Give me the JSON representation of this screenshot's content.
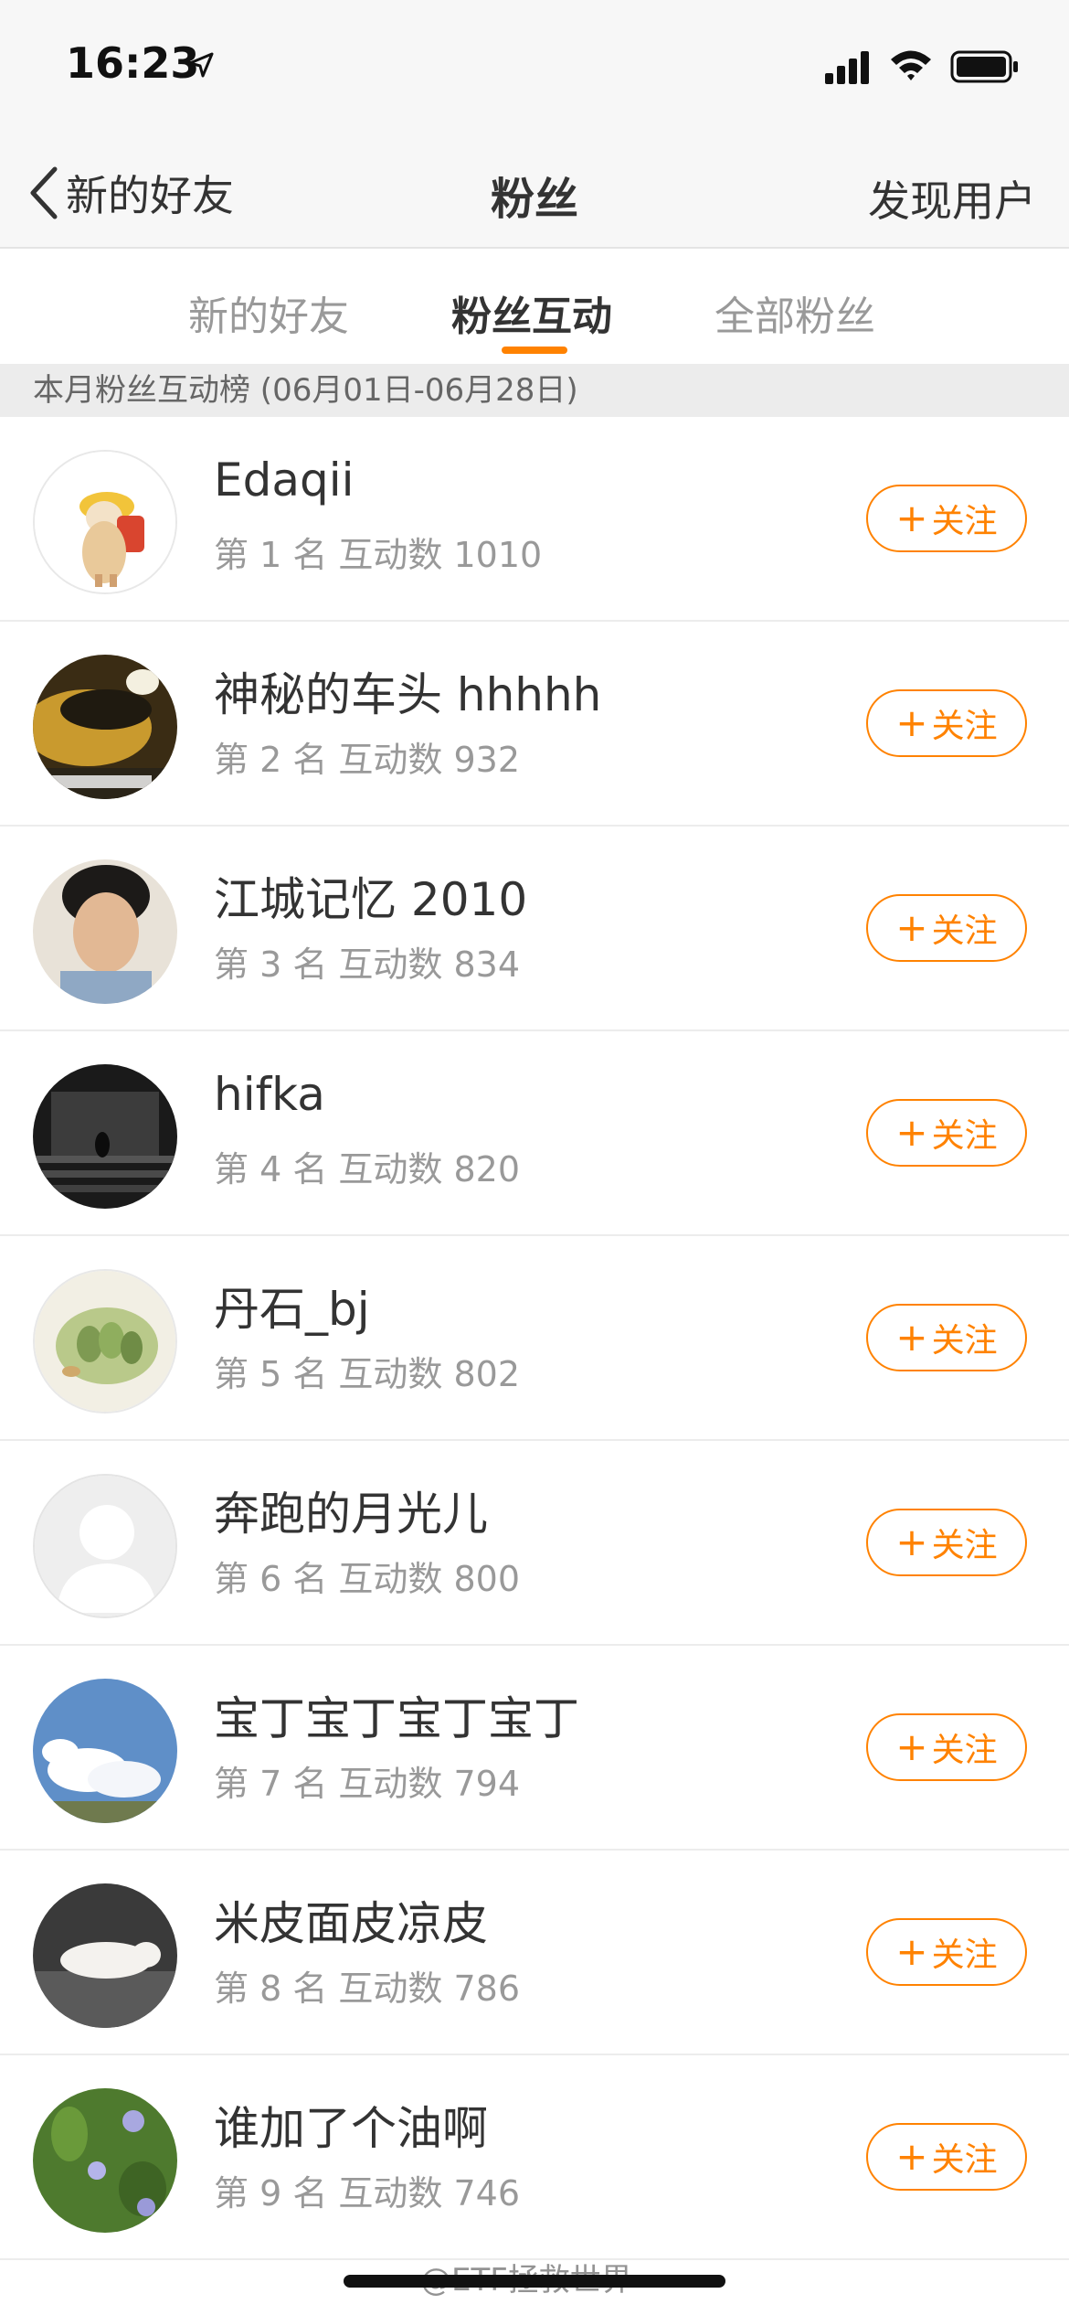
{
  "status_bar": {
    "time": "16:23"
  },
  "nav": {
    "back_label": "新的好友",
    "title": "粉丝",
    "right_action": "发现用户"
  },
  "tabs": [
    {
      "label": "新的好友"
    },
    {
      "label": "粉丝互动"
    },
    {
      "label": "全部粉丝"
    }
  ],
  "active_tab": "粉丝互动",
  "section_header": "本月粉丝互动榜 (06月01日-06月28日)",
  "follow_label": "关注",
  "fans": [
    {
      "name": "Edaqii",
      "rank": "第 1 名  互动数 1010"
    },
    {
      "name": "神秘的车头 hhhhh",
      "rank": "第 2 名  互动数 932"
    },
    {
      "name": "江城记忆 2010",
      "rank": "第 3 名  互动数 834"
    },
    {
      "name": "hifka",
      "rank": "第 4 名  互动数 820"
    },
    {
      "name": "丹石_bj",
      "rank": "第 5 名  互动数 802"
    },
    {
      "name": "奔跑的月光儿",
      "rank": "第 6 名  互动数 800"
    },
    {
      "name": "宝丁宝丁宝丁宝丁",
      "rank": "第 7 名  互动数 794"
    },
    {
      "name": "米皮面皮凉皮",
      "rank": "第 8 名  互动数 786"
    },
    {
      "name": "谁加了个油啊",
      "rank": "第 9 名  互动数 746"
    }
  ],
  "watermark": "@ETF拯救世界",
  "colors": {
    "accent": "#ff8200",
    "nav_bg": "#f7f7f7",
    "section_bg": "#ececec"
  }
}
